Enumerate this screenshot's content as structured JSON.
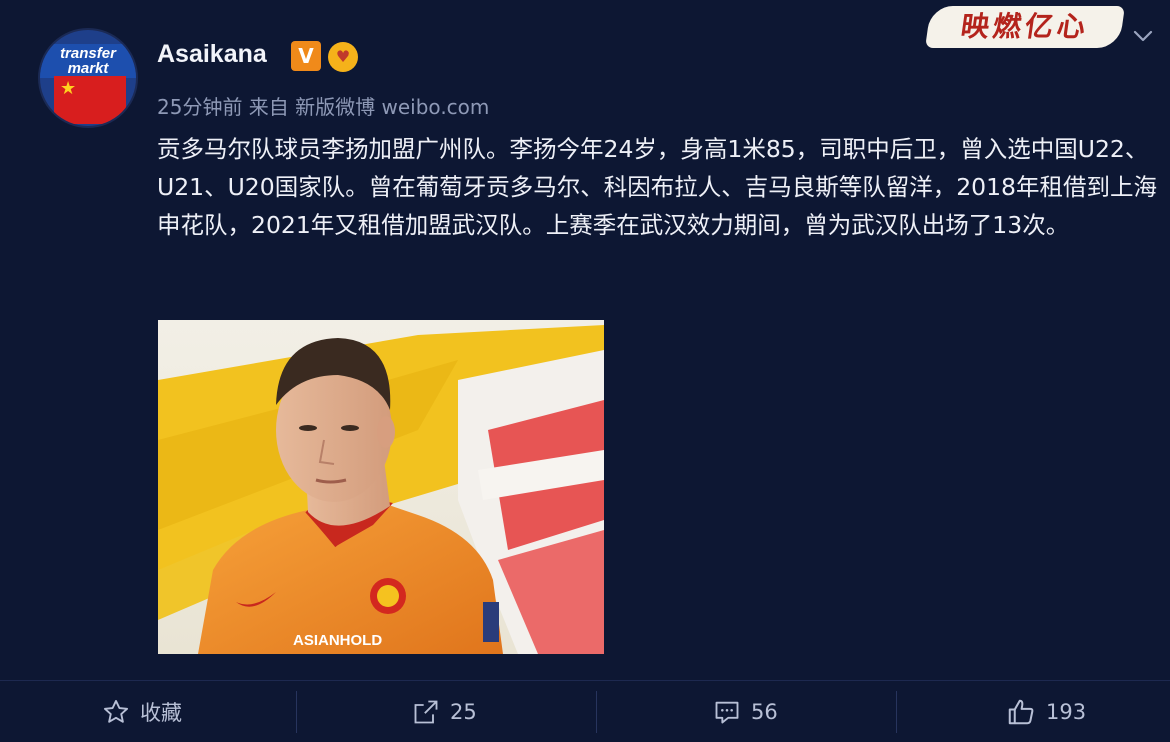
{
  "post": {
    "avatar_logo_line1": "transfer",
    "avatar_logo_line2": "markt",
    "username": "Asaikana",
    "verified_label": "V",
    "meta": "25分钟前 来自 新版微博 weibo.com",
    "brand_label": "映燃亿心",
    "paragraph": "贡多马尔队球员李扬加盟广州队。李扬今年24岁，身高1米85，司职中后卫，曾入选中国U22、U21、U20国家队。曾在葡萄牙贡多马尔、科因布拉人、吉马良斯等队留洋，2018年租借到上海申花队，2021年又租借加盟武汉队。上赛季在武汉效力期间，曾为武汉队出场了13次。",
    "photo_jersey_sponsor": "ASIANHOLD"
  },
  "actions": {
    "favorite": {
      "icon": "star-icon",
      "label": "收藏"
    },
    "repost": {
      "icon": "share-icon",
      "label": "25"
    },
    "comment": {
      "icon": "comment-icon",
      "label": "56"
    },
    "like": {
      "icon": "thumbs-up-icon",
      "label": "193"
    }
  },
  "colors": {
    "background": "#0d1733",
    "text": "#eef0f7",
    "meta": "#8e99b6",
    "verified": "#f08a1a",
    "jersey": "#f08a2a"
  }
}
